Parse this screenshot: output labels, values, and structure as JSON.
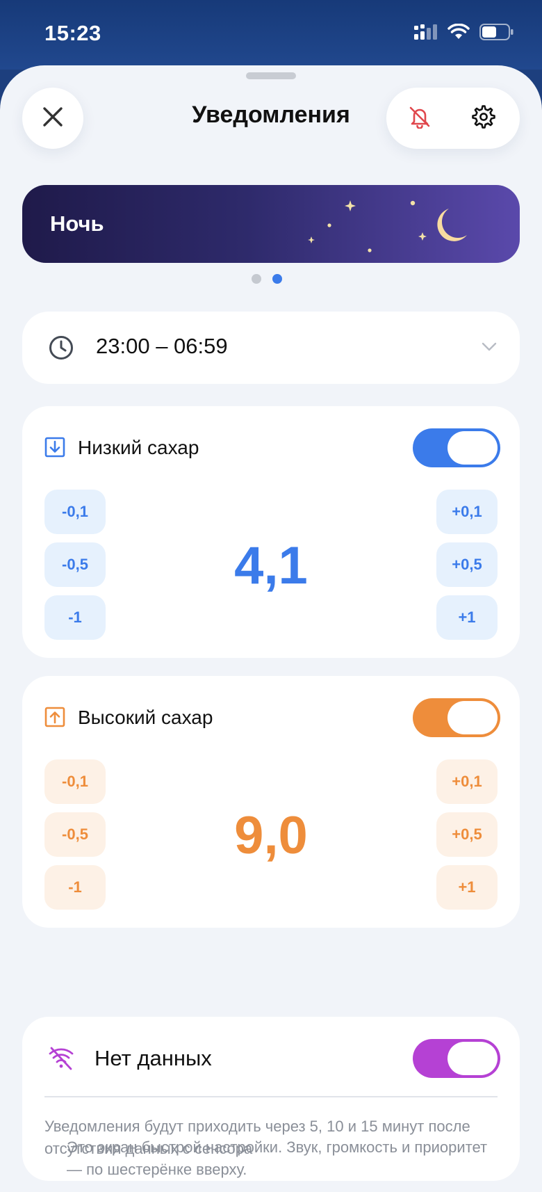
{
  "status": {
    "time": "15:23"
  },
  "header": {
    "title": "Уведомления"
  },
  "banner": {
    "label": "Ночь",
    "page_count": 2,
    "active_page": 2
  },
  "schedule": {
    "time_range": "23:00 – 06:59"
  },
  "low_sugar": {
    "label": "Низкий сахар",
    "enabled": true,
    "value": "4,1",
    "minus": [
      "-0,1",
      "-0,5",
      "-1"
    ],
    "plus": [
      "+0,1",
      "+0,5",
      "+1"
    ],
    "color": "#3b7bea"
  },
  "high_sugar": {
    "label": "Высокий сахар",
    "enabled": true,
    "value": "9,0",
    "minus": [
      "-0,1",
      "-0,5",
      "-1"
    ],
    "plus": [
      "+0,1",
      "+0,5",
      "+1"
    ],
    "color": "#ee8d3b"
  },
  "no_data": {
    "label": "Нет данных",
    "enabled": true,
    "description": "Уведомления будут приходить через 5, 10 и 15 минут после отсутствия данных с сенсора",
    "color": "#b541d4"
  },
  "footer": {
    "note": "Это экран быстрой настройки. Звук, громкость и приоритет — по шестерёнке вверху."
  },
  "icons": {
    "close": "close-icon",
    "mute": "bell-off-icon",
    "settings": "gear-icon",
    "clock": "clock-icon",
    "low": "arrow-down-box-icon",
    "high": "arrow-up-box-icon",
    "no_data": "wifi-off-icon"
  }
}
